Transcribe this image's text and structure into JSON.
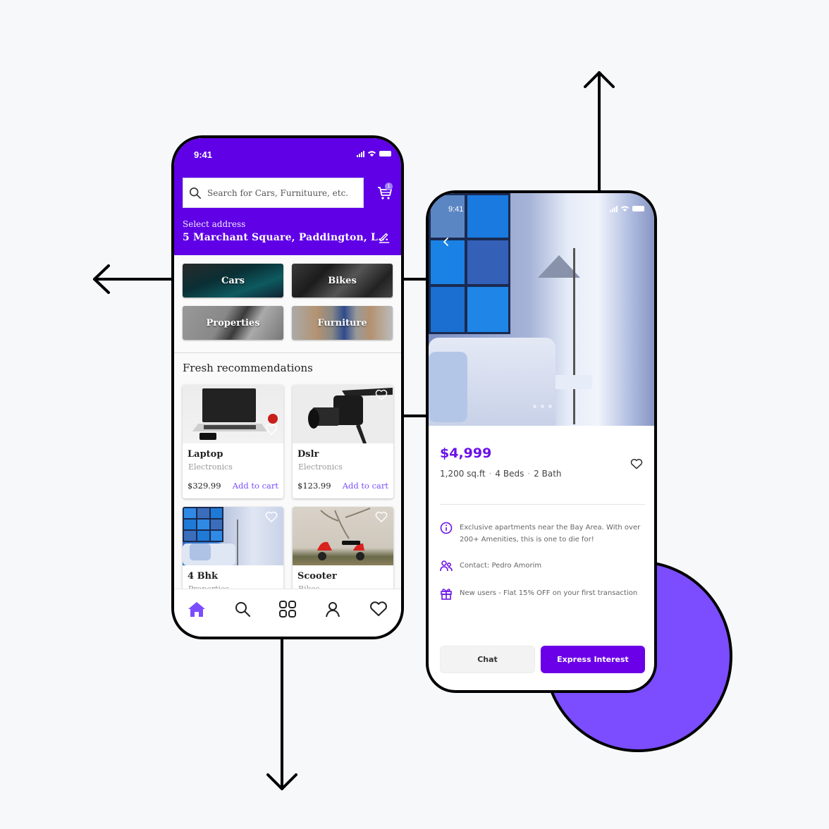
{
  "colors": {
    "brand": "#5f00e6",
    "accent": "#7b4dff",
    "price": "#6b12e8",
    "background": "#f6f8fa"
  },
  "home_screen": {
    "status_bar": {
      "time": "9:41"
    },
    "search": {
      "placeholder": "Search for Cars, Furnituure, etc.",
      "value": "",
      "icon": "search-icon"
    },
    "cart": {
      "icon": "cart-icon",
      "badge": "1"
    },
    "address": {
      "label": "Select address",
      "value": "5 Marchant Square, Paddington, L...",
      "edit_icon": "edit-icon"
    },
    "categories": [
      {
        "label": "Cars"
      },
      {
        "label": "Bikes"
      },
      {
        "label": "Properties"
      },
      {
        "label": "Furniture"
      }
    ],
    "section_title": "Fresh recommendations",
    "products": [
      {
        "name": "Laptop",
        "category": "Electronics",
        "price": "$329.99",
        "action": "Add to cart"
      },
      {
        "name": "Dslr",
        "category": "Electronics",
        "price": "$123.99",
        "action": "Add to cart"
      },
      {
        "name": "4 Bhk",
        "category": "Properties",
        "price": "",
        "action": ""
      },
      {
        "name": "Scooter",
        "category": "Bikes",
        "price": "",
        "action": ""
      }
    ],
    "bottom_nav": [
      {
        "icon": "home-icon",
        "active": true
      },
      {
        "icon": "search-icon",
        "active": false
      },
      {
        "icon": "grid-icon",
        "active": false
      },
      {
        "icon": "profile-icon",
        "active": false
      },
      {
        "icon": "heart-icon",
        "active": false
      }
    ]
  },
  "detail_screen": {
    "status_bar": {
      "time": "9:41"
    },
    "carousel": {
      "total": 3
    },
    "price": "$4,999",
    "specs": [
      "1,200 sq.ft",
      "4 Beds",
      "2 Bath"
    ],
    "spec_separator": "·",
    "info": [
      {
        "icon": "info-icon",
        "text": "Exclusive apartments near the Bay Area. With over 200+ Amenities, this is one to die for!"
      },
      {
        "icon": "users-icon",
        "text": "Contact: Pedro Amorim"
      },
      {
        "icon": "gift-icon",
        "text": "New users - Flat 15% OFF on your first transaction"
      }
    ],
    "buttons": {
      "chat": "Chat",
      "express_interest": "Express Interest"
    }
  }
}
